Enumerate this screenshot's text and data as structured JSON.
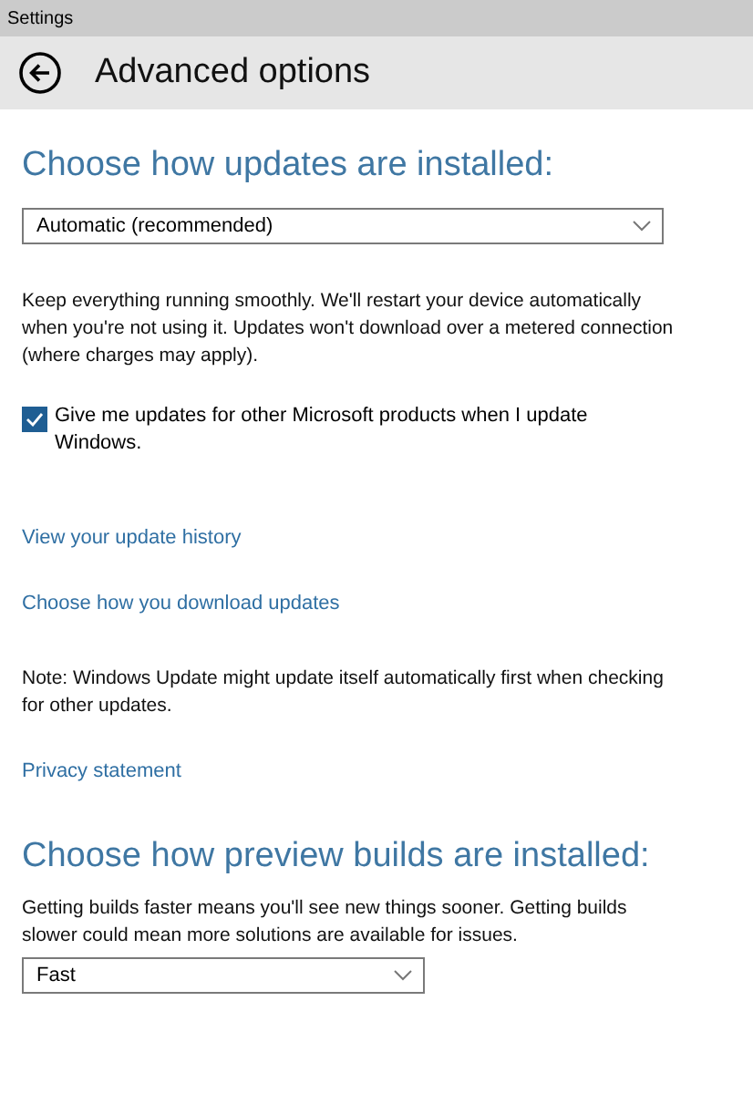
{
  "window": {
    "title": "Settings"
  },
  "header": {
    "title": "Advanced options"
  },
  "content": [
    {
      "kind": "heading",
      "text": "Choose how updates are installed:"
    },
    {
      "kind": "dropdown",
      "value": "Automatic (recommended)"
    },
    {
      "kind": "paragraph",
      "text": "Keep everything running smoothly. We'll restart your device automatically when you're not using it. Updates won't download over a metered connection (where charges may apply)."
    },
    {
      "kind": "checkbox",
      "text": "Give me updates for other Microsoft products when I update Windows.",
      "checked": true
    },
    {
      "kind": "link",
      "text": "View your update history"
    },
    {
      "kind": "link",
      "text": "Choose how you download updates"
    },
    {
      "kind": "paragraph",
      "text": "Note: Windows Update might update itself automatically first when checking for other updates."
    },
    {
      "kind": "link",
      "text": "Privacy statement"
    },
    {
      "kind": "heading",
      "text": "Choose how preview builds are installed:"
    },
    {
      "kind": "paragraph",
      "text": "Getting builds faster means you'll see new things sooner. Getting builds slower could mean more solutions are available for issues."
    },
    {
      "kind": "dropdown",
      "value": "Fast"
    }
  ]
}
